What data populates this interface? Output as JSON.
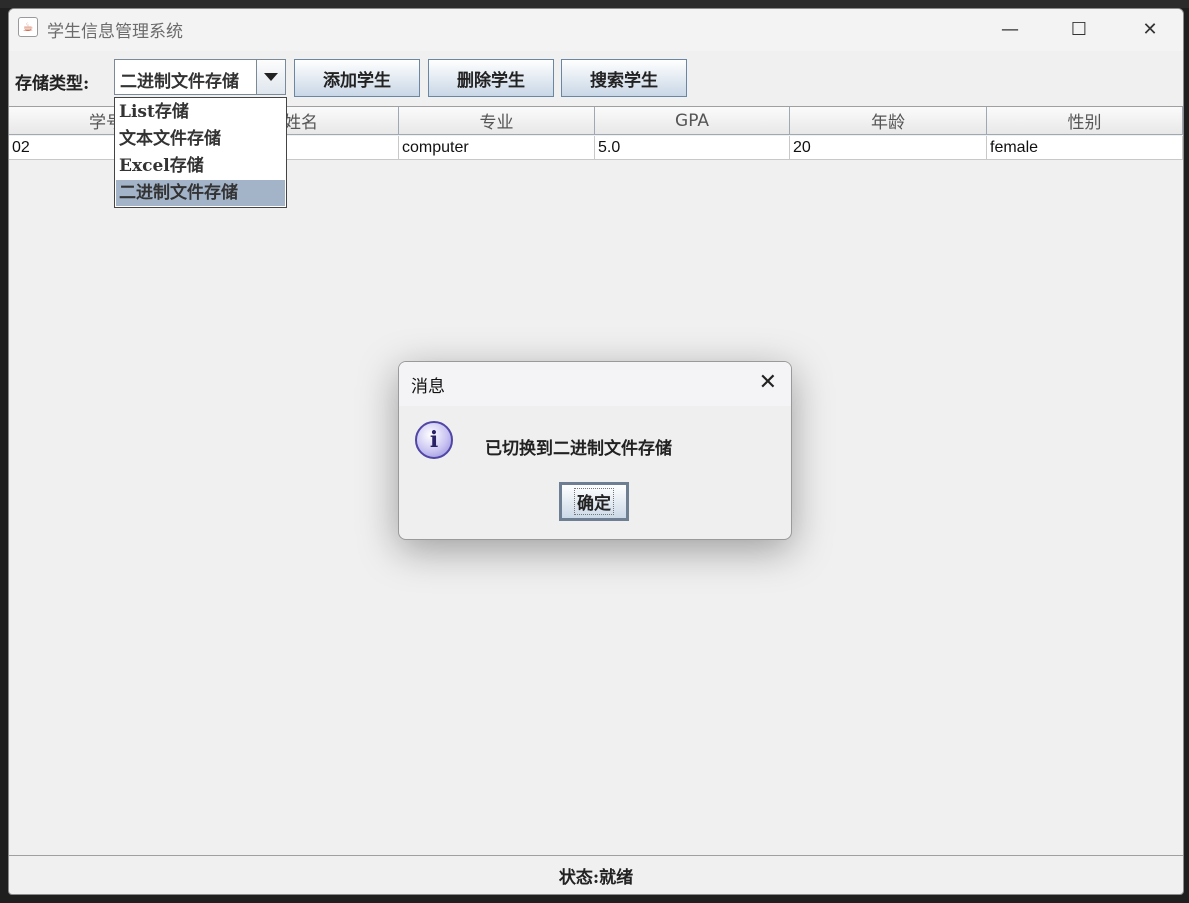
{
  "window": {
    "title": "学生信息管理系统",
    "app_icon": "java-coffee-icon",
    "minimize_icon": "—",
    "maximize_icon": "☐",
    "close_icon": "✕"
  },
  "toolbar": {
    "storage_label": "存储类型:",
    "storage_selected": "二进制文件存储",
    "add_label": "添加学生",
    "delete_label": "删除学生",
    "search_label": "搜索学生"
  },
  "storage_options": [
    "List存储",
    "文本文件存储",
    "Excel存储",
    "二进制文件存储"
  ],
  "table": {
    "headers": [
      "学号",
      "姓名",
      "专业",
      "GPA",
      "年龄",
      "性别"
    ],
    "rows": [
      [
        "02",
        "",
        "computer",
        "5.0",
        "20",
        "female"
      ]
    ]
  },
  "status": {
    "text": "状态:就绪"
  },
  "dialog": {
    "title": "消息",
    "close_icon": "✕",
    "icon": "info-icon",
    "message": "已切换到二进制文件存储",
    "ok_label": "确定"
  }
}
